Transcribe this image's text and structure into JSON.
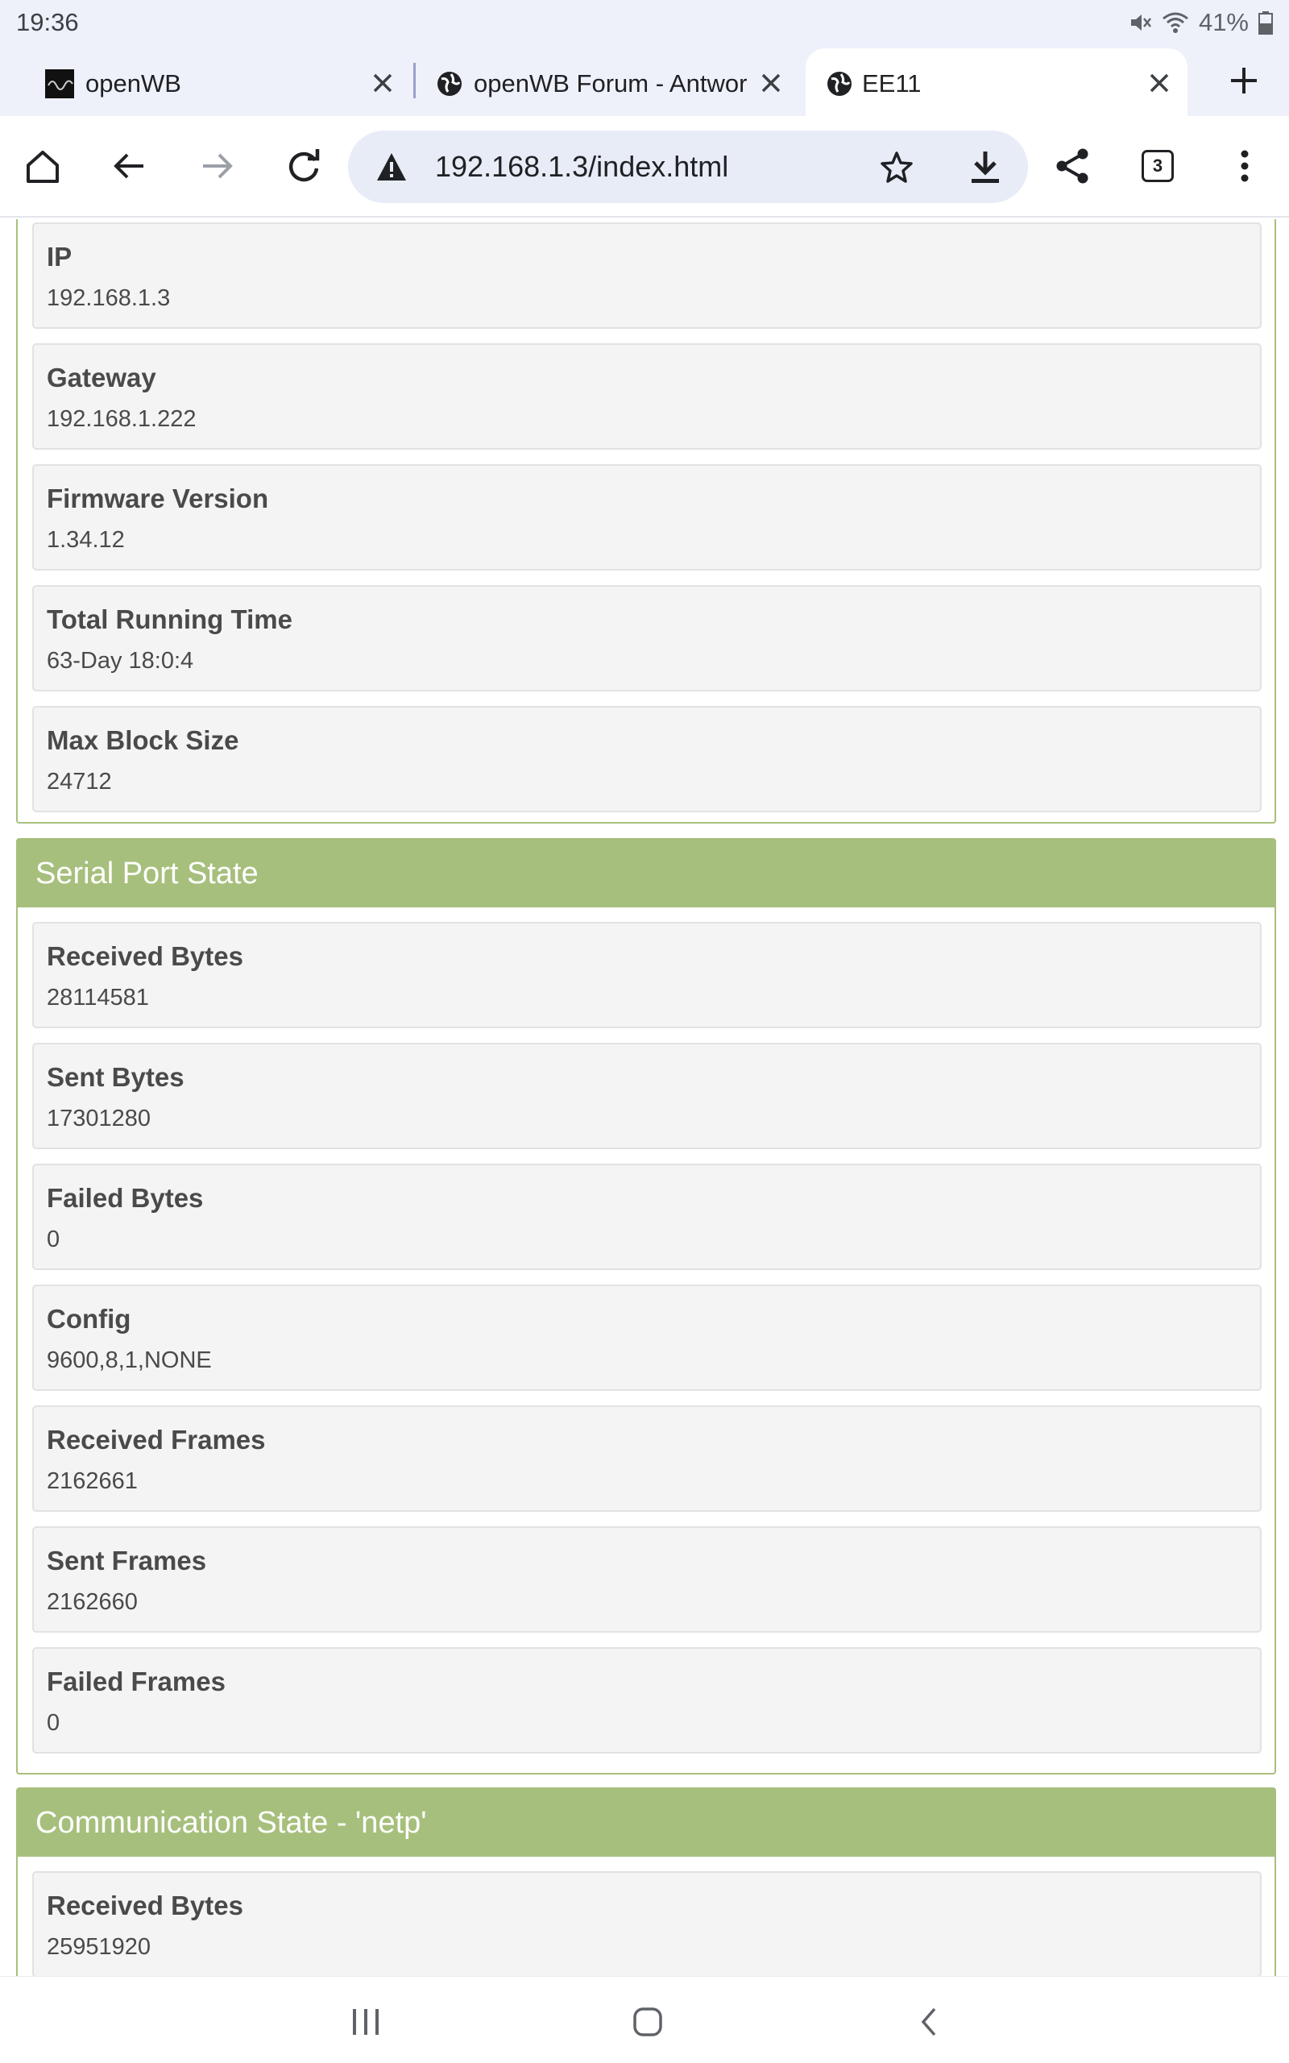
{
  "status_bar": {
    "time": "19:36",
    "battery": "41%"
  },
  "tabs": [
    {
      "title": "openWB",
      "icon": "openwb-favicon",
      "active": false
    },
    {
      "title": "openWB Forum - Antwor",
      "icon": "globe-icon",
      "active": false
    },
    {
      "title": "EE11",
      "icon": "globe-icon",
      "active": true
    }
  ],
  "toolbar": {
    "url": "192.168.1.3/index.html",
    "tab_count": "3"
  },
  "sections": {
    "system": {
      "fields": [
        {
          "label": "IP",
          "value": "192.168.1.3"
        },
        {
          "label": "Gateway",
          "value": "192.168.1.222"
        },
        {
          "label": "Firmware Version",
          "value": "1.34.12"
        },
        {
          "label": "Total Running Time",
          "value": "63-Day 18:0:4"
        },
        {
          "label": "Max Block Size",
          "value": "24712"
        }
      ]
    },
    "serial": {
      "title": "Serial Port State",
      "fields": [
        {
          "label": "Received Bytes",
          "value": "28114581"
        },
        {
          "label": "Sent Bytes",
          "value": "17301280"
        },
        {
          "label": "Failed Bytes",
          "value": "0"
        },
        {
          "label": "Config",
          "value": "9600,8,1,NONE"
        },
        {
          "label": "Received Frames",
          "value": "2162661"
        },
        {
          "label": "Sent Frames",
          "value": "2162660"
        },
        {
          "label": "Failed Frames",
          "value": "0"
        }
      ]
    },
    "comm": {
      "title": "Communication State - 'netp'",
      "fields": [
        {
          "label": "Received Bytes",
          "value": "25951920"
        }
      ]
    }
  },
  "colors": {
    "panel_accent": "#a7bf7c",
    "chrome_bg": "#eef1fa",
    "field_bg": "#f4f4f4"
  }
}
